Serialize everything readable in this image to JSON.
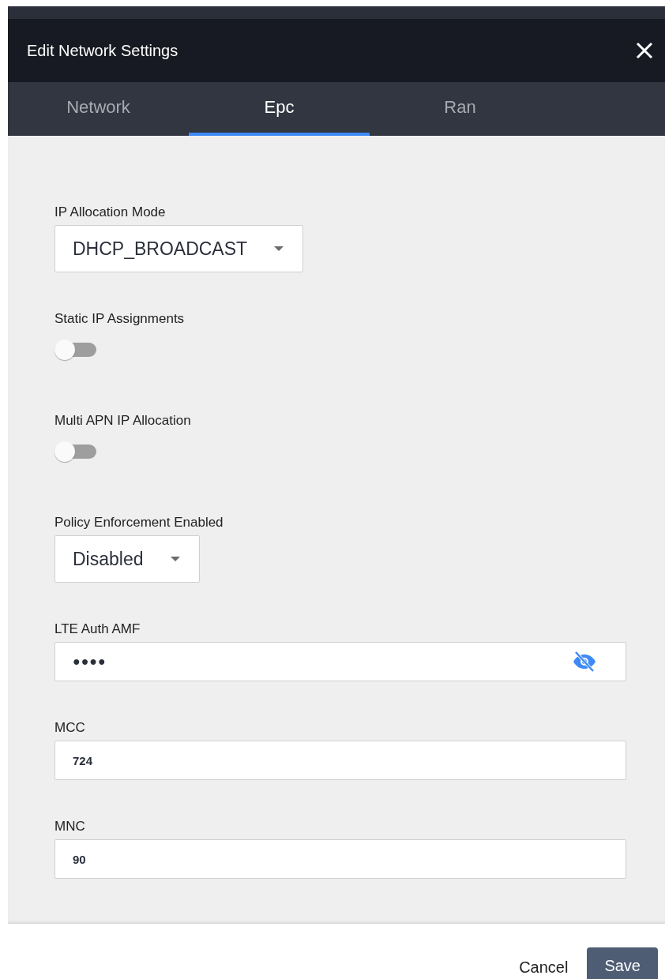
{
  "dialog": {
    "title": "Edit Network Settings"
  },
  "tabs": [
    {
      "label": "Network",
      "selected": false
    },
    {
      "label": "Epc",
      "selected": true
    },
    {
      "label": "Ran",
      "selected": false
    }
  ],
  "fields": [
    {
      "kind": "select",
      "label": "IP Allocation Mode",
      "value": "DHCP_BROADCAST"
    },
    {
      "kind": "toggle",
      "label": "Static IP Assignments",
      "on": false
    },
    {
      "kind": "toggle",
      "label": "Multi APN IP Allocation",
      "on": false
    },
    {
      "kind": "select",
      "label": "Policy Enforcement Enabled",
      "value": "Disabled"
    },
    {
      "kind": "password",
      "label": "LTE Auth AMF",
      "value": "●●●●"
    },
    {
      "kind": "text",
      "label": "MCC",
      "value": "724"
    },
    {
      "kind": "text",
      "label": "MNC",
      "value": "90"
    }
  ],
  "buttons": [
    {
      "label": "Cancel",
      "kind": "text"
    },
    {
      "label": "Save",
      "kind": "primary"
    }
  ]
}
